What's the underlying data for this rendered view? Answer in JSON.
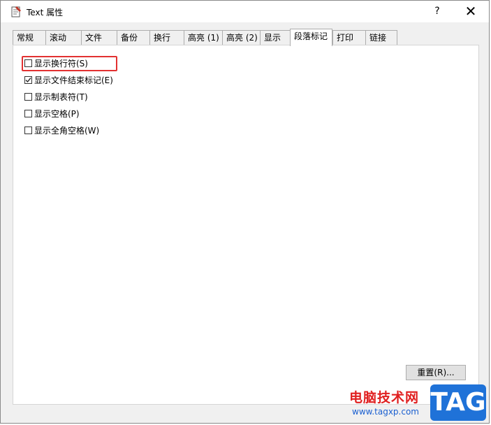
{
  "window": {
    "title": "Text 属性",
    "help_label": "?",
    "close_label": "✕"
  },
  "tabs": [
    {
      "label": "常规"
    },
    {
      "label": "滚动"
    },
    {
      "label": "文件"
    },
    {
      "label": "备份"
    },
    {
      "label": "换行"
    },
    {
      "label": "高亮 (1)"
    },
    {
      "label": "高亮 (2)"
    },
    {
      "label": "显示"
    },
    {
      "label": "段落标记",
      "active": true
    },
    {
      "label": "打印"
    },
    {
      "label": "链接"
    }
  ],
  "options": [
    {
      "label": "显示换行符(S)",
      "checked": false
    },
    {
      "label": "显示文件结束标记(E)",
      "checked": true
    },
    {
      "label": "显示制表符(T)",
      "checked": false
    },
    {
      "label": "显示空格(P)",
      "checked": false
    },
    {
      "label": "显示全角空格(W)",
      "checked": false
    }
  ],
  "reset_button": "重置(R)...",
  "watermark": {
    "site_name": "电脑技术网",
    "url": "www.tagxp.com",
    "logo": "TAG"
  },
  "colors": {
    "highlight": "#e23131",
    "logo_bg": "#1f72d8"
  }
}
